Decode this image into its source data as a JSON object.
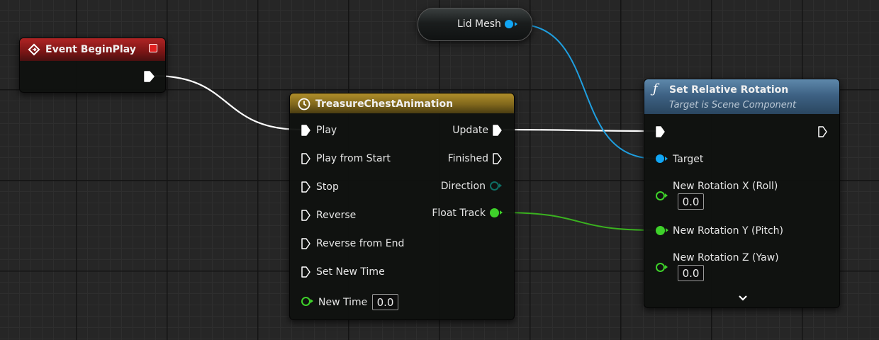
{
  "colors": {
    "exec": "#ffffff",
    "object": "#00a8f0",
    "float": "#3ed12a",
    "event_header": "#8d1a1a",
    "timeline_header": "#8a7020",
    "function_header": "#3e6284"
  },
  "event_node": {
    "title": "Event BeginPlay"
  },
  "variable_node": {
    "label": "Lid Mesh"
  },
  "timeline_node": {
    "title": "TreasureChestAnimation",
    "inputs": [
      "Play",
      "Play from Start",
      "Stop",
      "Reverse",
      "Reverse from End",
      "Set New Time"
    ],
    "new_time_label": "New Time",
    "new_time_value": "0.0",
    "outputs": [
      "Update",
      "Finished",
      "Direction",
      "Float Track"
    ]
  },
  "function_node": {
    "icon": "function-icon",
    "title": "Set Relative Rotation",
    "subtitle": "Target is Scene Component",
    "target_label": "Target",
    "x_label": "New Rotation X (Roll)",
    "x_value": "0.0",
    "y_label": "New Rotation Y (Pitch)",
    "z_label": "New Rotation Z (Yaw)",
    "z_value": "0.0",
    "expand_icon": "chevron-down-icon"
  }
}
